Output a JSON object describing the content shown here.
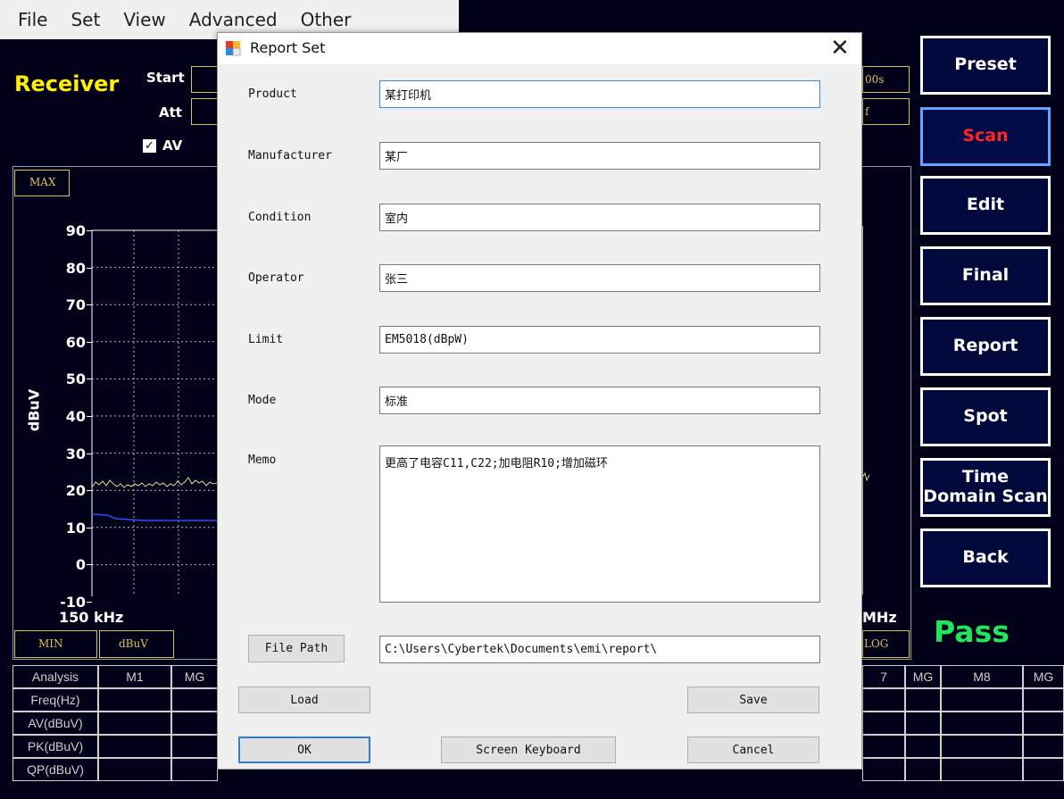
{
  "menu": [
    "File",
    "Set",
    "View",
    "Advanced",
    "Other"
  ],
  "receiver": {
    "title": "Receiver",
    "start_label": "Start",
    "att_label": "Att",
    "av_checkbox_label": "AV",
    "time_field_suffix": "00s",
    "att_field_suffix": "f"
  },
  "plot": {
    "max_badge": "MAX",
    "min_badge": "MIN",
    "unit_badge": "dBuV",
    "log_badge": "LOG",
    "y_axis_label": "dBuV",
    "y_ticks": [
      "90",
      "80",
      "70",
      "60",
      "50",
      "40",
      "30",
      "20",
      "10",
      "0",
      "-10"
    ],
    "x_start_label": "150 kHz",
    "x_end_label": "MHz"
  },
  "side_buttons": [
    {
      "label": "Preset",
      "active": false
    },
    {
      "label": "Scan",
      "active": true
    },
    {
      "label": "Edit",
      "active": false
    },
    {
      "label": "Final",
      "active": false
    },
    {
      "label": "Report",
      "active": false
    },
    {
      "label": "Spot",
      "active": false
    },
    {
      "label": "Time Domain Scan",
      "active": false
    },
    {
      "label": "Back",
      "active": false
    }
  ],
  "pass_status": "Pass",
  "colors": {
    "accent_yellow": "#fff000",
    "pass_green": "#1fe65a",
    "active_button_text": "#ff2626",
    "trace_yellow": "#e8dc9a",
    "trace_blue": "#2e4cff"
  },
  "table": {
    "row_headers": [
      "Analysis",
      "Freq(Hz)",
      "AV(dBuV)",
      "PK(dBuV)",
      "QP(dBuV)"
    ],
    "visible_column_headers": [
      "M1",
      "MG",
      "7",
      "MG",
      "M8",
      "MG"
    ]
  },
  "dialog": {
    "title": "Report Set",
    "close_glyph": "✕",
    "fields": [
      {
        "label": "Product",
        "value": "某打印机"
      },
      {
        "label": "Manufacturer",
        "value": "某厂"
      },
      {
        "label": "Condition",
        "value": "室内"
      },
      {
        "label": "Operator",
        "value": "张三"
      },
      {
        "label": "Limit",
        "value": "EM5018(dBpW)"
      },
      {
        "label": "Mode",
        "value": "标准"
      }
    ],
    "memo_label": "Memo",
    "memo_value": "更高了电容C11,C22;加电阻R10;增加磁环",
    "file_path_button": "File Path",
    "file_path_value": "C:\\Users\\Cybertek\\Documents\\emi\\report\\",
    "load_button": "Load",
    "save_button": "Save",
    "ok_button": "OK",
    "keyboard_button": "Screen Keyboard",
    "cancel_button": "Cancel"
  }
}
